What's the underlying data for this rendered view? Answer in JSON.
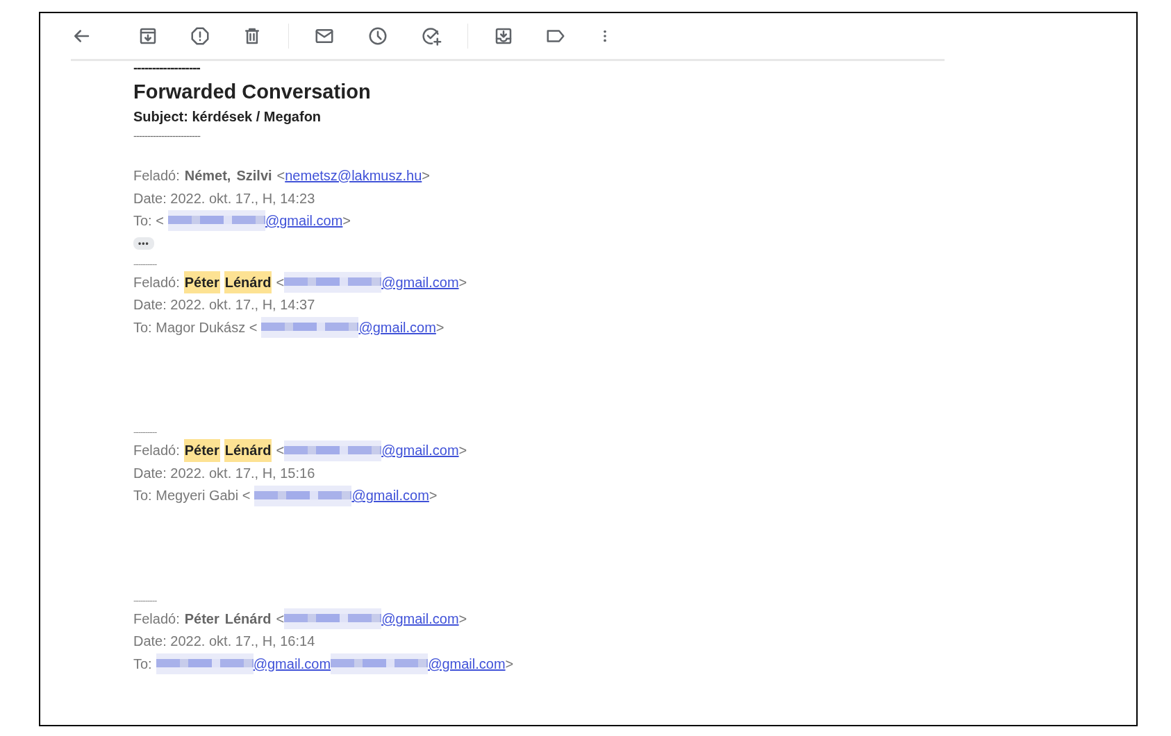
{
  "toolbar": {
    "buttons": [
      {
        "kind": "back"
      },
      {
        "kind": "archive"
      },
      {
        "kind": "report"
      },
      {
        "kind": "delete"
      },
      {
        "kind": "divider"
      },
      {
        "kind": "mail"
      },
      {
        "kind": "snooze"
      },
      {
        "kind": "task"
      },
      {
        "kind": "divider"
      },
      {
        "kind": "move"
      },
      {
        "kind": "label"
      },
      {
        "kind": "more"
      }
    ]
  },
  "body": [
    {
      "kind": "title_rule",
      "text": "------------------"
    },
    {
      "kind": "title",
      "text": "Forwarded Conversation"
    },
    {
      "kind": "subject",
      "text": "Subject: kérdések / Megafon"
    },
    {
      "kind": "subject_rule",
      "text": "------------------------"
    },
    {
      "kind": "message",
      "from_label": "Feladó:",
      "sender": [
        {
          "text": "Német,",
          "highlighted": false
        },
        {
          "text": "Szilvi",
          "highlighted": false
        }
      ],
      "from_address": [
        {
          "kind": "text",
          "text": "<"
        },
        {
          "kind": "link",
          "text": "nemetsz@lakmusz.hu"
        },
        {
          "kind": "text",
          "text": ">"
        }
      ],
      "date": "Date: 2022. okt. 17., H, 14:23",
      "to": [
        {
          "kind": "text",
          "text": "To: <"
        },
        {
          "kind": "redaction"
        },
        {
          "kind": "link",
          "text": "@gmail.com"
        },
        {
          "kind": "text",
          "text": ">"
        }
      ]
    },
    {
      "kind": "more_button",
      "text": "•••"
    },
    {
      "kind": "message_rule",
      "text": "----------"
    },
    {
      "kind": "message",
      "from_label": "Feladó:",
      "sender": [
        {
          "text": "Péter",
          "highlighted": true
        },
        {
          "text": "Lénárd",
          "highlighted": true
        }
      ],
      "from_address": [
        {
          "kind": "text",
          "text": "<"
        },
        {
          "kind": "redaction"
        },
        {
          "kind": "link",
          "text": "@gmail.com"
        },
        {
          "kind": "text",
          "text": ">"
        }
      ],
      "date": "Date: 2022. okt. 17., H, 14:37",
      "to": [
        {
          "kind": "text",
          "text": "To: Magor Dukász <"
        },
        {
          "kind": "redaction"
        },
        {
          "kind": "link",
          "text": "@gmail.com"
        },
        {
          "kind": "text",
          "text": ">"
        }
      ]
    },
    {
      "kind": "message_rule",
      "text": "----------"
    },
    {
      "kind": "message",
      "from_label": "Feladó:",
      "sender": [
        {
          "text": "Péter",
          "highlighted": true
        },
        {
          "text": "Lénárd",
          "highlighted": true
        }
      ],
      "from_address": [
        {
          "kind": "text",
          "text": "<"
        },
        {
          "kind": "redaction"
        },
        {
          "kind": "link",
          "text": "@gmail.com"
        },
        {
          "kind": "text",
          "text": ">"
        }
      ],
      "date": "Date: 2022. okt. 17., H, 15:16",
      "to": [
        {
          "kind": "text",
          "text": "To: Megyeri Gabi <"
        },
        {
          "kind": "redaction"
        },
        {
          "kind": "link",
          "text": "@gmail.com"
        },
        {
          "kind": "text",
          "text": ">"
        }
      ]
    },
    {
      "kind": "message_rule",
      "text": "----------"
    },
    {
      "kind": "message",
      "from_label": "Feladó:",
      "sender": [
        {
          "text": "Péter",
          "highlighted": false
        },
        {
          "text": "Lénárd",
          "highlighted": false
        }
      ],
      "from_address": [
        {
          "kind": "text",
          "text": "<"
        },
        {
          "kind": "redaction"
        },
        {
          "kind": "link",
          "text": "@gmail.com"
        },
        {
          "kind": "text",
          "text": ">"
        }
      ],
      "date": "Date: 2022. okt. 17., H, 16:14",
      "to": [
        {
          "kind": "text",
          "text": "To:"
        },
        {
          "kind": "redaction"
        },
        {
          "kind": "link",
          "text": "@gmail.com"
        },
        {
          "kind": "redaction"
        },
        {
          "kind": "link",
          "text": "@gmail.com"
        },
        {
          "kind": "text",
          "text": ">"
        }
      ]
    }
  ]
}
